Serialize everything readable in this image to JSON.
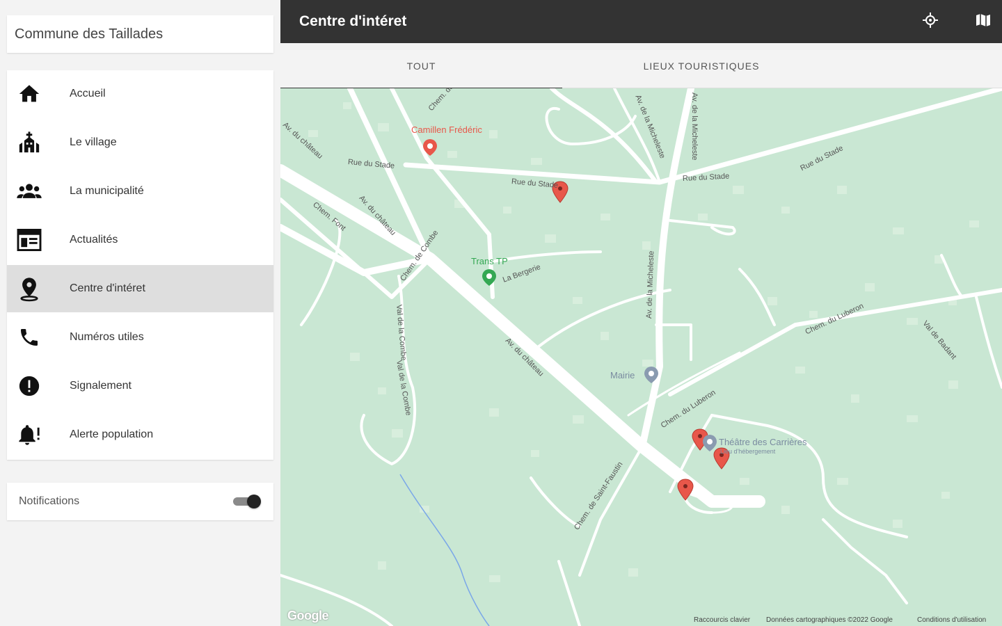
{
  "sidebar": {
    "commune_name": "Commune des Taillades",
    "items": [
      {
        "label": "Accueil",
        "icon": "home-icon"
      },
      {
        "label": "Le village",
        "icon": "church-icon"
      },
      {
        "label": "La municipalité",
        "icon": "people-icon"
      },
      {
        "label": "Actualités",
        "icon": "newspaper-icon"
      },
      {
        "label": "Centre d'intéret",
        "icon": "location-pin-icon"
      },
      {
        "label": "Numéros utiles",
        "icon": "phone-icon"
      },
      {
        "label": "Signalement",
        "icon": "alert-circle-icon"
      },
      {
        "label": "Alerte population",
        "icon": "bell-alert-icon"
      }
    ],
    "active_item": "Centre d'intéret",
    "notifications": {
      "label": "Notifications",
      "enabled": true
    }
  },
  "topbar": {
    "title": "Centre d'intéret",
    "actions": [
      {
        "icon": "locate-icon"
      },
      {
        "icon": "map-icon"
      }
    ]
  },
  "tabs": [
    {
      "label": "TOUT",
      "active": true
    },
    {
      "label": "LIEUX TOURISTIQUES",
      "active": false
    }
  ],
  "map": {
    "streets": [
      "Chem. de F",
      "Av. du château",
      "Rue du Stade",
      "Rue du Stade",
      "Rue du Stade",
      "Rue du Stade",
      "Chem. Font",
      "Av. du château",
      "La Bergerie",
      "Av. de la Micheleste",
      "Av. de la Micheleste",
      "Av. du château",
      "Chem. du Luberon",
      "Chem. du Luberon",
      "Val de Badant",
      "Chem. de Saint-Faustin",
      "Val de la Combe",
      "Val de la Combe",
      "Av. de la Micheleste",
      "Chem. de Combe"
    ],
    "pois": [
      {
        "name": "Camillen Frédéric",
        "color": "#e8574a"
      },
      {
        "name": "Trans TP",
        "color": "#34a853"
      },
      {
        "name": "Mairie",
        "color": "#8a9bb0"
      },
      {
        "name": "Théâtre des Carrières",
        "subtitle": "Lieu d'hébergement",
        "color": "#8a9bb0"
      }
    ],
    "footer": {
      "shortcuts": "Raccourcis clavier",
      "data": "Données cartographiques ©2022 Google",
      "terms": "Conditions d'utilisation"
    },
    "logo": "Google",
    "colors": {
      "land": "#c9e7d3",
      "road": "#ffffff",
      "marker": "#e8574a",
      "water": "#7aa7e8"
    }
  }
}
